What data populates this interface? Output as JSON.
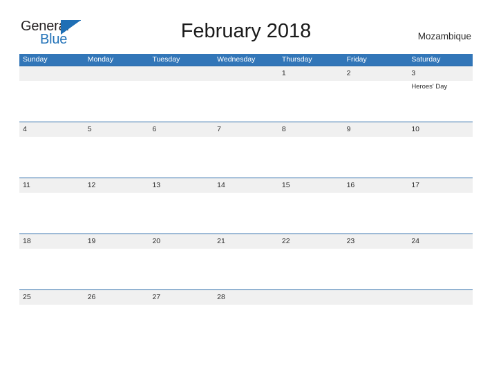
{
  "brand": {
    "name_part1": "General",
    "name_part2": "Blue",
    "flag_icon": "blue-triangle-flag-icon",
    "primary_color": "#2272b8"
  },
  "header": {
    "title": "February 2018",
    "country": "Mozambique"
  },
  "theme": {
    "header_blue": "#3276b8",
    "rule_blue": "#2a6aa8",
    "band_gray": "#f0f0f0",
    "text": "#2b2b2b"
  },
  "calendar": {
    "month": "February",
    "year": "2018",
    "weekday_headers": [
      "Sunday",
      "Monday",
      "Tuesday",
      "Wednesday",
      "Thursday",
      "Friday",
      "Saturday"
    ],
    "weeks": [
      [
        {
          "date": "",
          "events": []
        },
        {
          "date": "",
          "events": []
        },
        {
          "date": "",
          "events": []
        },
        {
          "date": "",
          "events": []
        },
        {
          "date": "1",
          "events": []
        },
        {
          "date": "2",
          "events": []
        },
        {
          "date": "3",
          "events": [
            "Heroes' Day"
          ]
        }
      ],
      [
        {
          "date": "4",
          "events": []
        },
        {
          "date": "5",
          "events": []
        },
        {
          "date": "6",
          "events": []
        },
        {
          "date": "7",
          "events": []
        },
        {
          "date": "8",
          "events": []
        },
        {
          "date": "9",
          "events": []
        },
        {
          "date": "10",
          "events": []
        }
      ],
      [
        {
          "date": "11",
          "events": []
        },
        {
          "date": "12",
          "events": []
        },
        {
          "date": "13",
          "events": []
        },
        {
          "date": "14",
          "events": []
        },
        {
          "date": "15",
          "events": []
        },
        {
          "date": "16",
          "events": []
        },
        {
          "date": "17",
          "events": []
        }
      ],
      [
        {
          "date": "18",
          "events": []
        },
        {
          "date": "19",
          "events": []
        },
        {
          "date": "20",
          "events": []
        },
        {
          "date": "21",
          "events": []
        },
        {
          "date": "22",
          "events": []
        },
        {
          "date": "23",
          "events": []
        },
        {
          "date": "24",
          "events": []
        }
      ],
      [
        {
          "date": "25",
          "events": []
        },
        {
          "date": "26",
          "events": []
        },
        {
          "date": "27",
          "events": []
        },
        {
          "date": "28",
          "events": []
        },
        {
          "date": "",
          "events": []
        },
        {
          "date": "",
          "events": []
        },
        {
          "date": "",
          "events": []
        }
      ]
    ]
  }
}
